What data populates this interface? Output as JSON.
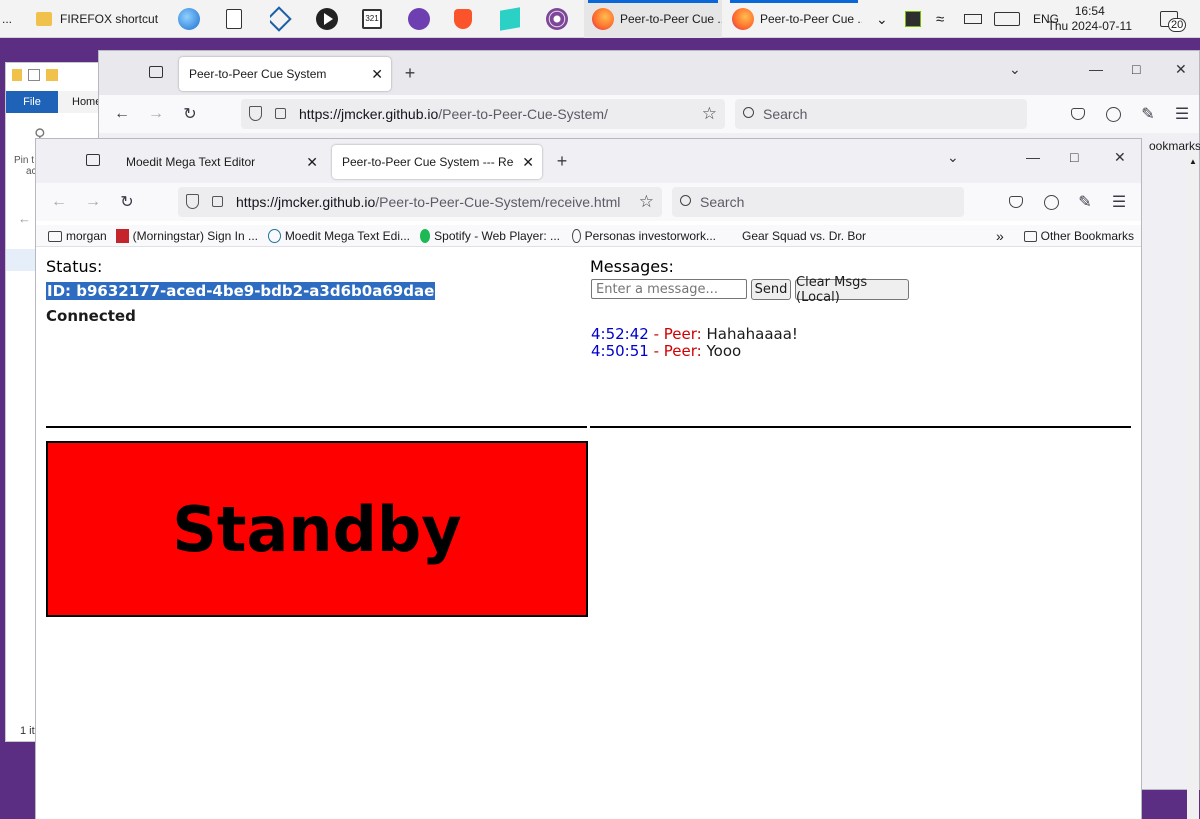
{
  "taskbar": {
    "leading": "...",
    "explorer_item": "FIREFOX shortcut",
    "window_1": "Peer-to-Peer Cue ...",
    "window_2": "Peer-to-Peer Cue ...",
    "lang": "ENG",
    "time": "16:54",
    "date": "Thu 2024-07-11",
    "notifications": "20",
    "accent": "#0a67d8"
  },
  "explorer": {
    "file_tab": "File",
    "home_tab": "Home",
    "pin_label": "Pin t",
    "pin_label2": "ac",
    "status": "1 it"
  },
  "back_browser": {
    "tab_title": "Peer-to-Peer Cue System",
    "url_host": "https://jmcker.github.io",
    "url_path": "/Peer-to-Peer-Cue-System/",
    "search_placeholder": "Search",
    "bookmarks_partial": "ookmarks"
  },
  "front_browser": {
    "tabs": [
      {
        "title": "Moedit Mega Text Editor"
      },
      {
        "title": "Peer-to-Peer Cue System --- Receiv"
      }
    ],
    "url_host": "https://jmcker.github.io",
    "url_path": "/Peer-to-Peer-Cue-System/receive.html",
    "search_placeholder": "Search",
    "bookmarks": [
      {
        "label": "morgan",
        "icon": "folder-icon"
      },
      {
        "label": "(Morningstar) Sign In ...",
        "icon": "morningstar-icon"
      },
      {
        "label": "Moedit Mega Text Edi...",
        "icon": "wordpress-icon"
      },
      {
        "label": "Spotify - Web Player: ...",
        "icon": "spotify-icon"
      },
      {
        "label": "Personas investorwork...",
        "icon": "globe-icon"
      },
      {
        "label": "Gear Squad vs. Dr. Bor...",
        "icon": "none"
      }
    ],
    "other_bookmarks": "Other Bookmarks"
  },
  "page": {
    "status_label": "Status:",
    "peer_id": "ID: b9632177-aced-4be9-bdb2-a3d6b0a69dae",
    "connection": "Connected",
    "messages_label": "Messages:",
    "message_placeholder": "Enter a message...",
    "send_label": "Send",
    "clear_label": "Clear Msgs (Local)",
    "messages": [
      {
        "time": "4:52:42",
        "sep": " - ",
        "sender": "Peer:",
        "text": " Hahahaaaa!"
      },
      {
        "time": "4:50:51",
        "sep": " - ",
        "sender": "Peer:",
        "text": " Yooo"
      }
    ],
    "cue_state": "Standby",
    "cue_color": "#ff0000"
  }
}
